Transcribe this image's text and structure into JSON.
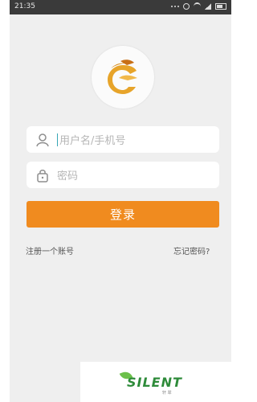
{
  "status_bar": {
    "time": "21:35"
  },
  "login": {
    "username_placeholder": "用户名/手机号",
    "password_placeholder": "密码",
    "login_button": "登录",
    "register_link": "注册一个账号",
    "forgot_link": "忘记密码?"
  },
  "watermark": {
    "text": "SILENT",
    "subtext": "轩 翠"
  },
  "colors": {
    "accent": "#f08b1f",
    "status_bar": "#3a3a3a",
    "background": "#efefef",
    "caret": "#36a6b5"
  }
}
